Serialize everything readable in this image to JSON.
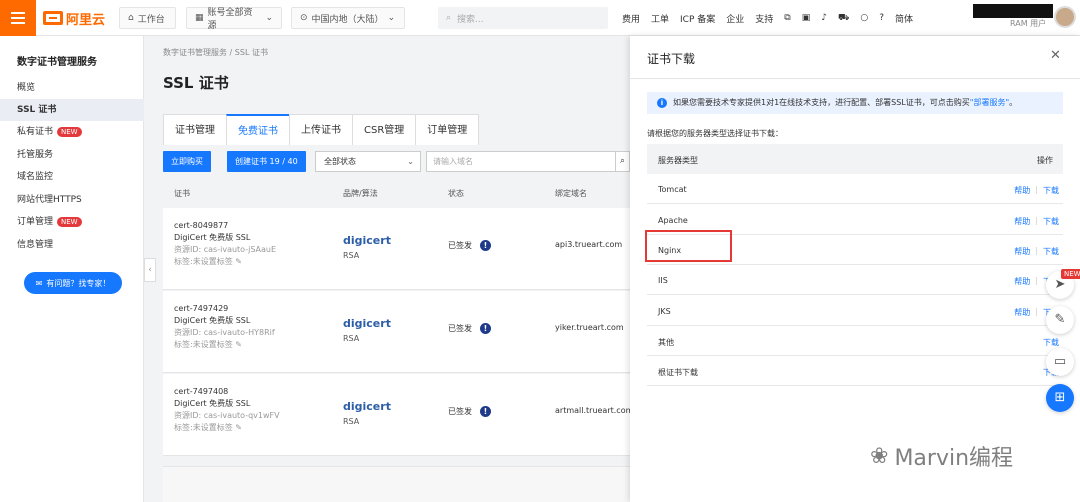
{
  "topbar": {
    "logo": "阿里云",
    "workbench": "工作台",
    "account": "账号全部资源",
    "region": "中国内地（大陆）",
    "search_placeholder": "搜索...",
    "nav": [
      "费用",
      "工单",
      "ICP 备案",
      "企业",
      "支持"
    ],
    "lang": "简体",
    "user_role": "RAM 用户"
  },
  "sidebar": {
    "title": "数字证书管理服务",
    "items": [
      {
        "label": "概览",
        "badge": ""
      },
      {
        "label": "SSL 证书",
        "badge": ""
      },
      {
        "label": "私有证书",
        "badge": "NEW"
      },
      {
        "label": "托管服务",
        "badge": ""
      },
      {
        "label": "域名监控",
        "badge": ""
      },
      {
        "label": "网站代理HTTPS",
        "badge": ""
      },
      {
        "label": "订单管理",
        "badge": "NEW"
      },
      {
        "label": "信息管理",
        "badge": ""
      }
    ],
    "expert_button": "有问题？找专家！"
  },
  "main": {
    "breadcrumb": [
      "数字证书管理服务",
      "SSL 证书"
    ],
    "title": "SSL 证书",
    "tabs": [
      "证书管理",
      "免费证书",
      "上传证书",
      "CSR管理",
      "订单管理"
    ],
    "buy_button": "立即购买",
    "create_button": "创建证书 19 / 40",
    "status_select": "全部状态",
    "domain_placeholder": "请输入域名",
    "columns": [
      "证书",
      "品牌/算法",
      "状态",
      "绑定域名"
    ],
    "rows": [
      {
        "id": "cert-8049877",
        "product": "DigiCert 免费版 SSL",
        "resource": "资源ID: cas-ivauto-jSAauE",
        "tag": "标签:未设置标签",
        "brand": "digicert",
        "algo": "RSA",
        "status": "已签发",
        "domain": "api3.trueart.com"
      },
      {
        "id": "cert-7497429",
        "product": "DigiCert 免费版 SSL",
        "resource": "资源ID: cas-ivauto-HY8Rif",
        "tag": "标签:未设置标签",
        "brand": "digicert",
        "algo": "RSA",
        "status": "已签发",
        "domain": "yiker.trueart.com"
      },
      {
        "id": "cert-7497408",
        "product": "DigiCert 免费版 SSL",
        "resource": "资源ID: cas-ivauto-qv1wFV",
        "tag": "标签:未设置标签",
        "brand": "digicert",
        "algo": "RSA",
        "status": "已签发",
        "domain": "artmall.trueart.com"
      }
    ]
  },
  "drawer": {
    "title": "证书下载",
    "info_text": "如果您需要技术专家提供1对1在线技术支持，进行配置、部署SSL证书，可点击购买",
    "info_link": "\"部署服务\"",
    "info_end": "。",
    "prompt": "请根据您的服务器类型选择证书下载：",
    "col_server": "服务器类型",
    "col_action": "操作",
    "rows": [
      {
        "name": "Tomcat",
        "help": "帮助",
        "download": "下载"
      },
      {
        "name": "Apache",
        "help": "帮助",
        "download": "下载"
      },
      {
        "name": "Nginx",
        "help": "帮助",
        "download": "下载"
      },
      {
        "name": "IIS",
        "help": "帮助",
        "download": "下载"
      },
      {
        "name": "JKS",
        "help": "帮助",
        "download": "下载"
      },
      {
        "name": "其他",
        "help": "",
        "download": "下载"
      },
      {
        "name": "根证书下载",
        "help": "",
        "download": "下载"
      }
    ]
  },
  "floating": {
    "new_badge": "NEW"
  },
  "watermark": "Marvin编程",
  "colors": {
    "brand": "#ff6a00",
    "primary": "#1677ff",
    "highlight": "#e53935"
  }
}
